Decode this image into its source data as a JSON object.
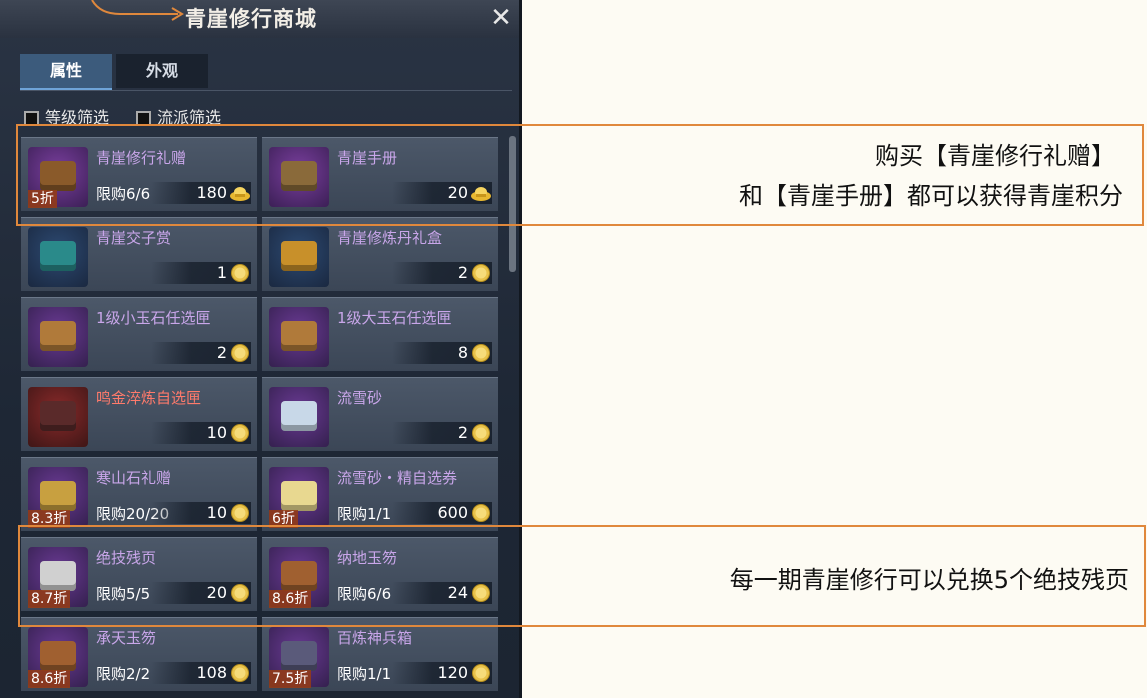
{
  "header": {
    "title": "青崖修行商城",
    "close_icon": "close-icon"
  },
  "tabs": [
    {
      "label": "属性"
    },
    {
      "label": "外观"
    }
  ],
  "filters": [
    {
      "label": "等级筛选",
      "checked": false
    },
    {
      "label": "流派筛选",
      "checked": false
    }
  ],
  "items": [
    {
      "name": "青崖修行礼赠",
      "limit": "限购6/6",
      "price": "180",
      "discount": "5折",
      "currency": "gold-ingot-icon",
      "color": "purple"
    },
    {
      "name": "青崖手册",
      "limit": "",
      "price": "20",
      "discount": "",
      "currency": "gold-ingot-icon",
      "color": "purple"
    },
    {
      "name": "青崖交子赏",
      "limit": "",
      "price": "1",
      "discount": "",
      "currency": "qingya-coin-icon",
      "color": "purple"
    },
    {
      "name": "青崖修炼丹礼盒",
      "limit": "",
      "price": "2",
      "discount": "",
      "currency": "qingya-coin-icon",
      "color": "purple"
    },
    {
      "name": "1级小玉石任选匣",
      "limit": "",
      "price": "2",
      "discount": "",
      "currency": "qingya-coin-icon",
      "color": "purple"
    },
    {
      "name": "1级大玉石任选匣",
      "limit": "",
      "price": "8",
      "discount": "",
      "currency": "qingya-coin-icon",
      "color": "purple"
    },
    {
      "name": "鸣金淬炼自选匣",
      "limit": "",
      "price": "10",
      "discount": "",
      "currency": "qingya-coin-icon",
      "color": "red"
    },
    {
      "name": "流雪砂",
      "limit": "",
      "price": "2",
      "discount": "",
      "currency": "qingya-coin-icon",
      "color": "purple"
    },
    {
      "name": "寒山石礼赠",
      "limit": "限购20/20",
      "price": "10",
      "discount": "8.3折",
      "currency": "qingya-coin-icon",
      "color": "purple"
    },
    {
      "name": "流雪砂・精自选券",
      "limit": "限购1/1",
      "price": "600",
      "discount": "6折",
      "currency": "qingya-coin-icon",
      "color": "purple"
    },
    {
      "name": "绝技残页",
      "limit": "限购5/5",
      "price": "20",
      "discount": "8.7折",
      "currency": "qingya-coin-icon",
      "color": "purple"
    },
    {
      "name": "纳地玉笏",
      "limit": "限购6/6",
      "price": "24",
      "discount": "8.6折",
      "currency": "qingya-coin-icon",
      "color": "purple"
    },
    {
      "name": "承天玉笏",
      "limit": "限购2/2",
      "price": "108",
      "discount": "8.6折",
      "currency": "qingya-coin-icon",
      "color": "purple"
    },
    {
      "name": "百炼神兵箱",
      "limit": "限购1/1",
      "price": "120",
      "discount": "7.5折",
      "currency": "qingya-coin-icon",
      "color": "purple"
    }
  ],
  "annotations": [
    {
      "line1": "购买【青崖修行礼赠】",
      "line2": "和【青崖手册】都可以获得青崖积分"
    },
    {
      "line1": "每一期青崖修行可以兑换5个绝技残页"
    }
  ],
  "colors": {
    "accent": "#e0883c",
    "item_name": "#c9a6ea",
    "item_name_red": "#ff7a6b"
  }
}
